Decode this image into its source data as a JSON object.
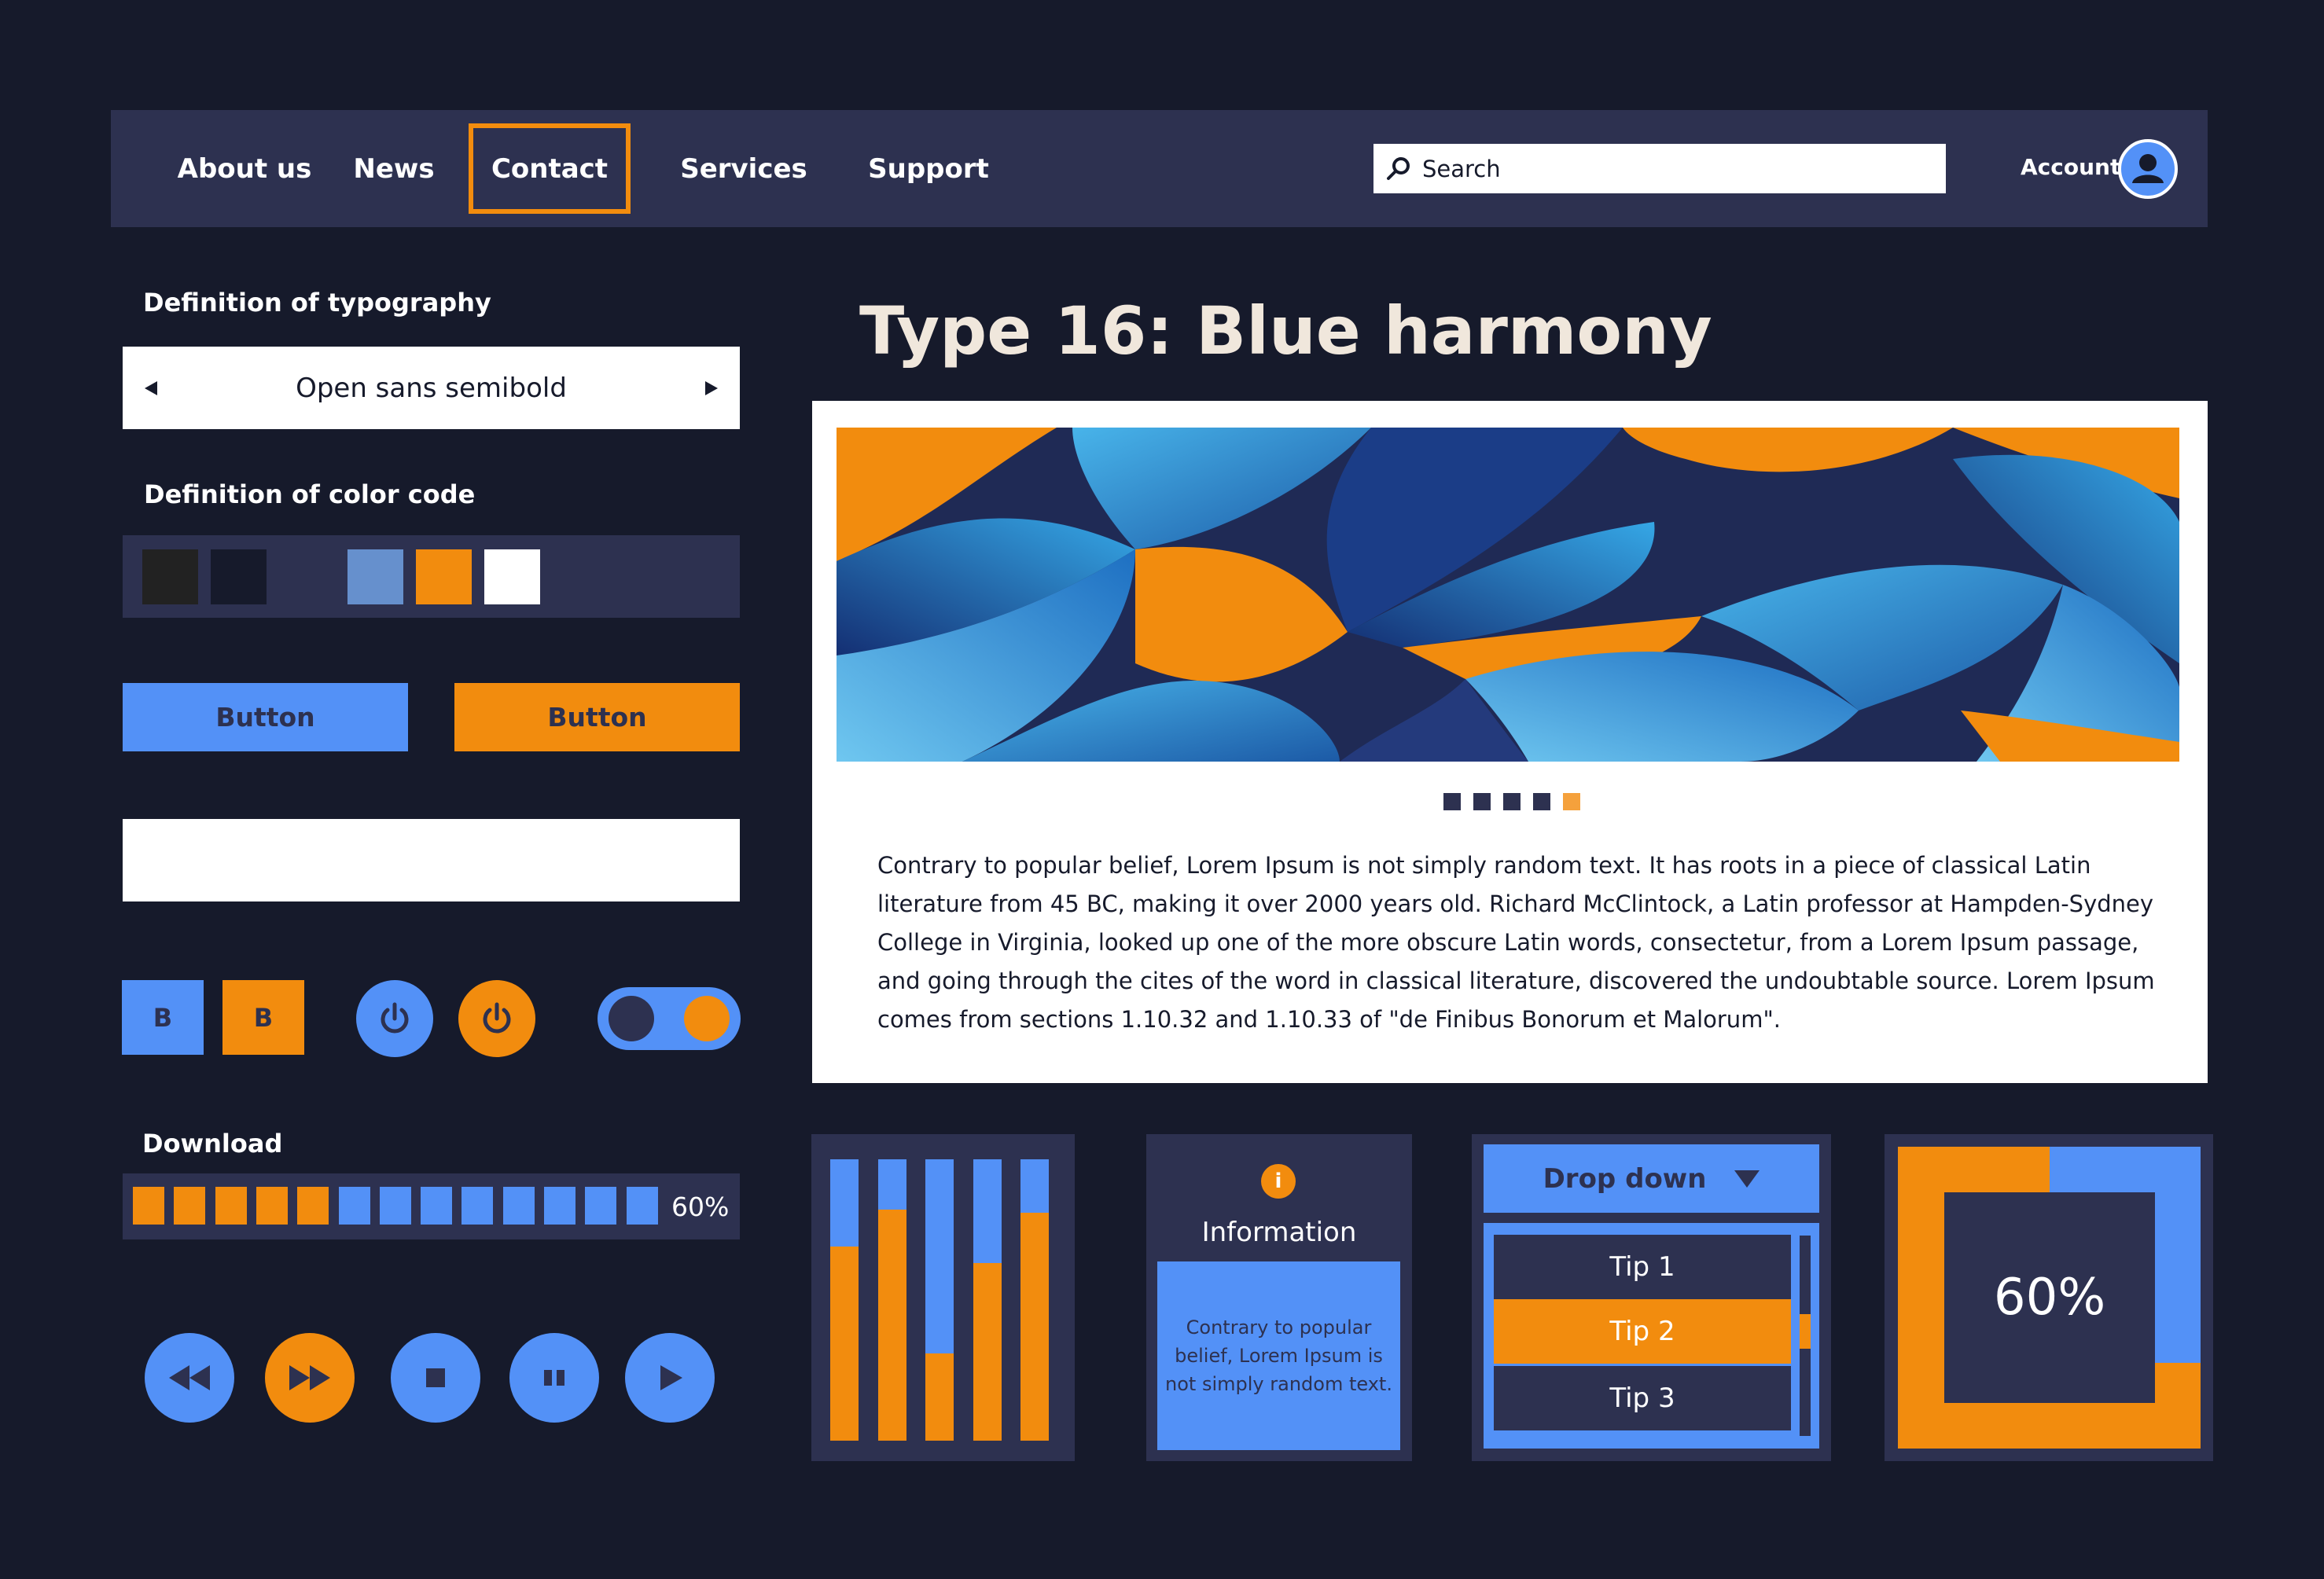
{
  "nav": {
    "items": [
      {
        "label": "About us"
      },
      {
        "label": "News"
      },
      {
        "label": "Contact",
        "active": true
      },
      {
        "label": "Services"
      },
      {
        "label": "Support"
      }
    ],
    "search_label": "Search",
    "account_label": "Account"
  },
  "typography": {
    "heading": "Definition of typography",
    "selected": "Open sans semibold"
  },
  "color_code": {
    "heading": "Definition of color code",
    "swatches": [
      "#222222",
      "#161a2b",
      "#2d3150",
      "#6690cd",
      "#f28c0e",
      "#ffffff"
    ]
  },
  "buttons": {
    "blue_label": "Button",
    "orange_label": "Button",
    "bold_blue": "B",
    "bold_orange": "B"
  },
  "download": {
    "heading": "Download",
    "percent_text": "60%",
    "filled_segments": 5,
    "total_segments": 13
  },
  "main": {
    "title": "Type 16: Blue harmony",
    "carousel": {
      "total": 5,
      "active_index": 4
    },
    "body": "Contrary to popular belief, Lorem Ipsum is not simply random text. It has roots in a piece of classical Latin literature from 45 BC, making it over 2000 years old. Richard McClintock, a Latin professor at Hampden-Sydney College in Virginia, looked up one of the more obscure Latin words, consectetur, from a Lorem Ipsum passage, and going through the cites of the word in classical literature, discovered the undoubtable source. Lorem Ipsum comes from sections 1.10.32 and 1.10.33 of \"de Finibus Bonorum et Malorum\"."
  },
  "bars": {
    "fill_fractions": [
      0.69,
      0.82,
      0.31,
      0.63,
      0.81
    ]
  },
  "info": {
    "icon": "i",
    "title": "Information",
    "body": "Contrary to popular belief, Lorem Ipsum is not simply random text."
  },
  "dropdown": {
    "label": "Drop down",
    "items": [
      "Tip 1",
      "Tip 2",
      "Tip 3"
    ],
    "selected_index": 1
  },
  "gauge": {
    "text": "60%",
    "value": 0.6
  },
  "colors": {
    "blue": "#5391f7",
    "orange": "#f28c0e",
    "panel": "#2d3150",
    "bg": "#161a2b"
  }
}
